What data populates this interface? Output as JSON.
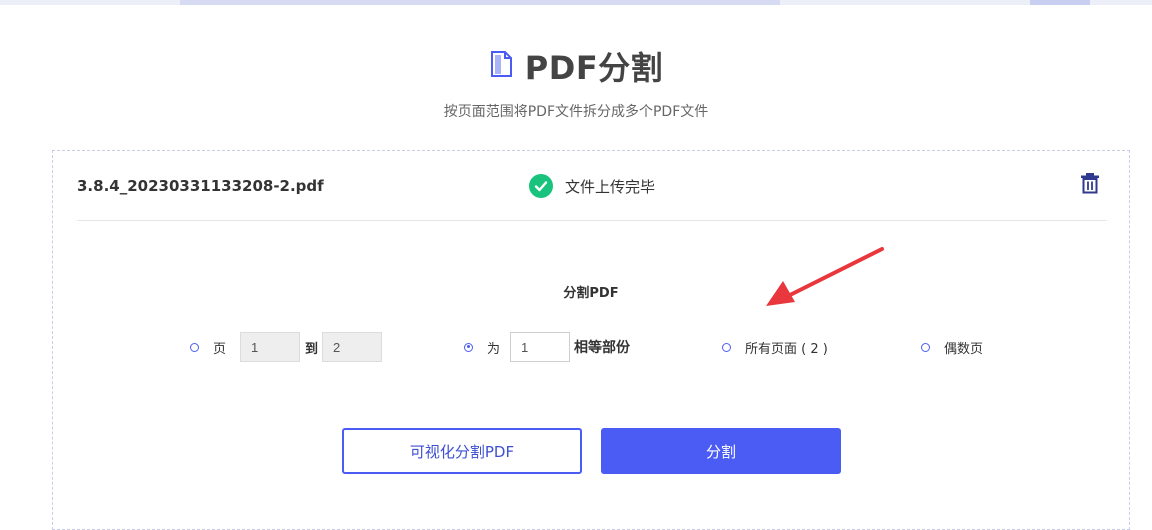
{
  "header": {
    "title": "PDF分割",
    "subtitle": "按页面范围将PDF文件拆分成多个PDF文件",
    "icon": "pdf-document-icon"
  },
  "file": {
    "name": "3.8.4_20230331133208-2.pdf",
    "status": "文件上传完毕",
    "status_icon": "check-circle-icon",
    "delete_icon": "trash-icon"
  },
  "split": {
    "section_title": "分割PDF",
    "options": {
      "range": {
        "label_prefix": "页",
        "from_value": "1",
        "to_label": "到",
        "to_value": "2",
        "selected": false
      },
      "equal": {
        "label_prefix": "为",
        "value": "1",
        "label_suffix": "相等部份",
        "selected": true
      },
      "all_pages": {
        "label": "所有页面 ( 2 )",
        "selected": false
      },
      "even_pages": {
        "label": "偶数页",
        "selected": false
      }
    }
  },
  "buttons": {
    "visual_split": "可视化分割PDF",
    "split": "分割"
  },
  "colors": {
    "accent": "#4b5cf5",
    "success": "#19c37d",
    "annotation_arrow": "#e8383d"
  }
}
